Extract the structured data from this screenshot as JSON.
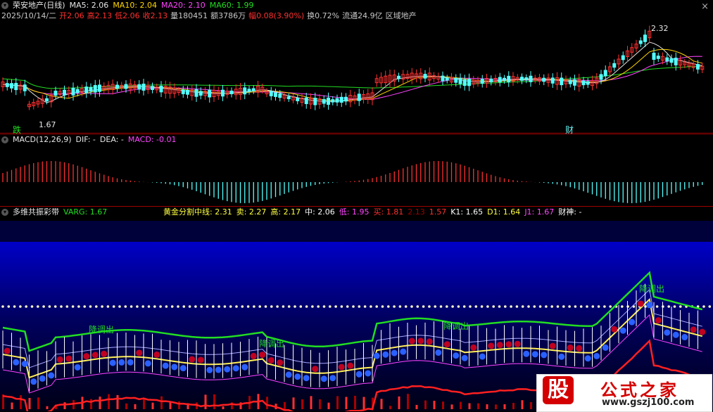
{
  "top": {
    "stock": "荣安地产(日线)",
    "ma": [
      {
        "label": "MA5: 2.06",
        "color": "#e6e6e6"
      },
      {
        "label": "MA10: 2.04",
        "color": "#ffd700"
      },
      {
        "label": "MA20: 2.10",
        "color": "#ff44ff"
      },
      {
        "label": "MA60: 1.99",
        "color": "#22dd22"
      }
    ],
    "info": [
      {
        "text": "2025/10/14/二",
        "color": "#c8c8c8"
      },
      {
        "text": "开2.06",
        "color": "#ff3030"
      },
      {
        "text": "高2.13",
        "color": "#ff3030"
      },
      {
        "text": "低2.06",
        "color": "#ff3030"
      },
      {
        "text": "收2.13",
        "color": "#ff3030"
      },
      {
        "text": "量180451",
        "color": "#c8c8c8"
      },
      {
        "text": "额3786万",
        "color": "#c8c8c8"
      },
      {
        "text": "幅0.08(3.90%)",
        "color": "#ff3030"
      },
      {
        "text": "换0.72%",
        "color": "#c8c8c8"
      },
      {
        "text": "流通24.9亿",
        "color": "#c8c8c8"
      },
      {
        "text": "区域地产",
        "color": "#c8c8c8"
      }
    ],
    "high_label": "2.32",
    "low_label": "1.67",
    "mark_die": "跌",
    "mark_cai": "财",
    "close_icon": "×"
  },
  "macd": {
    "title": "MACD(12,26,9)",
    "dif": "DIF: -",
    "dea": "DEA: -",
    "macd": "MACD: -0.01"
  },
  "band": {
    "title": "多维共振彩带",
    "varg": "VARG: 1.67",
    "fields": [
      {
        "text": "黄金分割中线: 2.31",
        "color": "#ffff40"
      },
      {
        "text": "卖: 2.27",
        "color": "#ffff40"
      },
      {
        "text": "高: 2.17",
        "color": "#ffff40"
      },
      {
        "text": "中: 2.06",
        "color": "#ffffff"
      },
      {
        "text": "低: 1.95",
        "color": "#ff44ff"
      },
      {
        "text": "买: 1.81",
        "color": "#ff3030"
      },
      {
        "text": "2.13",
        "color": "#a00000"
      },
      {
        "text": "1.57",
        "color": "#ff3030"
      },
      {
        "text": "K1: 1.65",
        "color": "#ffffff"
      },
      {
        "text": "D1: 1.64",
        "color": "#ffff40"
      },
      {
        "text": "J1: 1.67",
        "color": "#ff44ff"
      },
      {
        "text": "财神: -",
        "color": "#ffffff"
      }
    ],
    "labels": [
      "降调出",
      "降调出",
      "降调出",
      "降调出"
    ]
  },
  "logo": {
    "mark": "股",
    "name": "公式之家",
    "url": "www.gszj100.com"
  }
}
